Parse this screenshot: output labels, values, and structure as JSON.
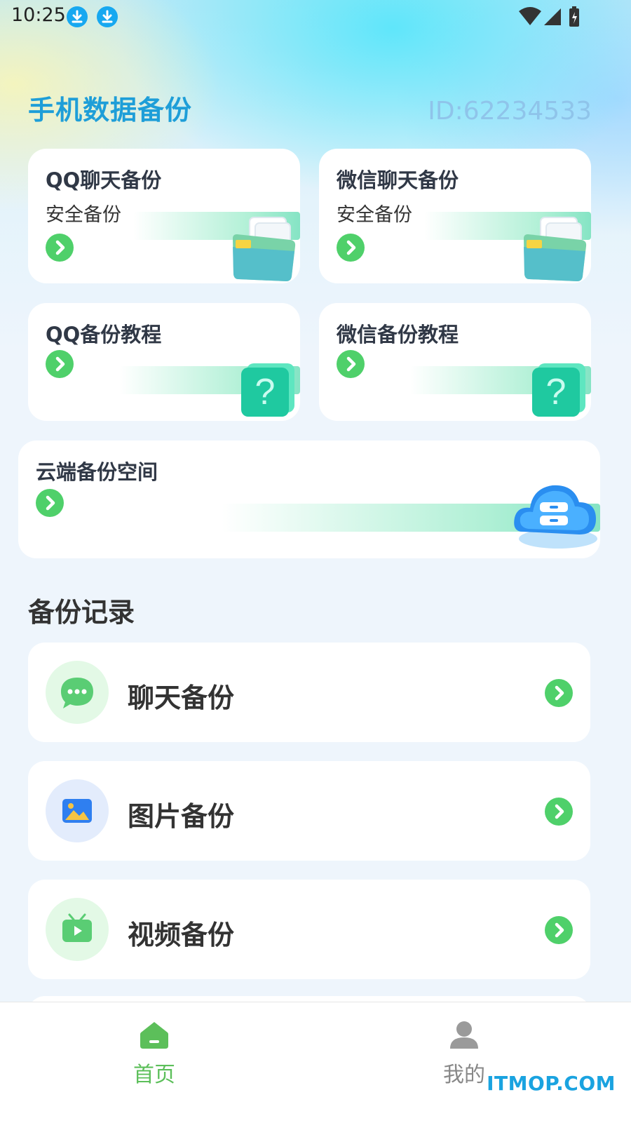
{
  "status_bar": {
    "time": "10:25",
    "icons": [
      "download-icon",
      "download-icon",
      "wifi-icon",
      "signal-icon",
      "battery-icon"
    ]
  },
  "header": {
    "title": "手机数据备份",
    "user_id": "ID:62234533"
  },
  "feature_cards": [
    {
      "title": "QQ聊天备份",
      "subtitle": "安全备份",
      "icon": "folder-icon"
    },
    {
      "title": "微信聊天备份",
      "subtitle": "安全备份",
      "icon": "folder-icon"
    },
    {
      "title": "QQ备份教程",
      "icon": "question-cube-icon"
    },
    {
      "title": "微信备份教程",
      "icon": "question-cube-icon"
    },
    {
      "title": "云端备份空间",
      "icon": "cloud-storage-icon"
    }
  ],
  "records": {
    "title": "备份记录",
    "items": [
      {
        "label": "聊天备份",
        "icon": "chat-icon",
        "icon_bg": "#e3f9e6"
      },
      {
        "label": "图片备份",
        "icon": "image-icon",
        "icon_bg": "#e3ecfc"
      },
      {
        "label": "视频备份",
        "icon": "tv-icon",
        "icon_bg": "#e3f9e6"
      }
    ]
  },
  "bottom_nav": {
    "items": [
      {
        "label": "首页",
        "icon": "home-icon",
        "active": true
      },
      {
        "label": "我的",
        "icon": "user-icon",
        "active": false
      }
    ]
  },
  "watermark": "ITMOP.COM",
  "colors": {
    "accent_green": "#4fd06a",
    "title_blue": "#1e9ed8",
    "active_nav": "#5cbf5a",
    "inactive_nav": "#888888"
  }
}
